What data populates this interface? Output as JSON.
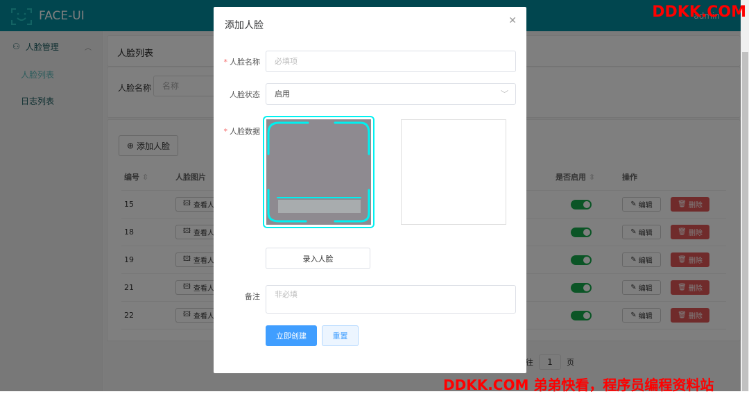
{
  "header": {
    "brand": "FACE-UI",
    "user": "admin"
  },
  "sidebar": {
    "group": "人脸管理",
    "items": [
      {
        "label": "人脸列表",
        "active": true
      },
      {
        "label": "日志列表",
        "active": false
      }
    ]
  },
  "main": {
    "page_title": "人脸列表",
    "search_label": "人脸名称",
    "search_placeholder": "名称",
    "add_button": "添加人脸",
    "columns": [
      "编号",
      "人脸图片",
      "是否启用",
      "操作"
    ],
    "rows": [
      {
        "id": "15",
        "view": "查看人脸",
        "enabled": true
      },
      {
        "id": "18",
        "view": "查看人脸",
        "enabled": true
      },
      {
        "id": "19",
        "view": "查看人脸",
        "enabled": true
      },
      {
        "id": "21",
        "view": "查看人脸",
        "enabled": true
      },
      {
        "id": "22",
        "view": "查看人脸",
        "enabled": true
      }
    ],
    "edit_label": "编辑",
    "delete_label": "删除",
    "pagination": {
      "goto_prefix": "往",
      "page": "1",
      "goto_suffix": "页"
    }
  },
  "modal": {
    "title": "添加人脸",
    "name_label": "人脸名称",
    "name_placeholder": "必填项",
    "status_label": "人脸状态",
    "status_value": "启用",
    "data_label": "人脸数据",
    "capture_button": "录入人脸",
    "remark_label": "备注",
    "remark_placeholder": "非必填",
    "submit": "立即创建",
    "reset": "重置"
  },
  "watermark": {
    "top": "DDKK.COM",
    "bottom": "DDKK.COM 弟弟快看，程序员编程资料站"
  },
  "colors": {
    "header": "#028c9f",
    "accent": "#00f0f0",
    "primary": "#409eff",
    "danger": "#e05656",
    "switch": "#17ab4c"
  }
}
